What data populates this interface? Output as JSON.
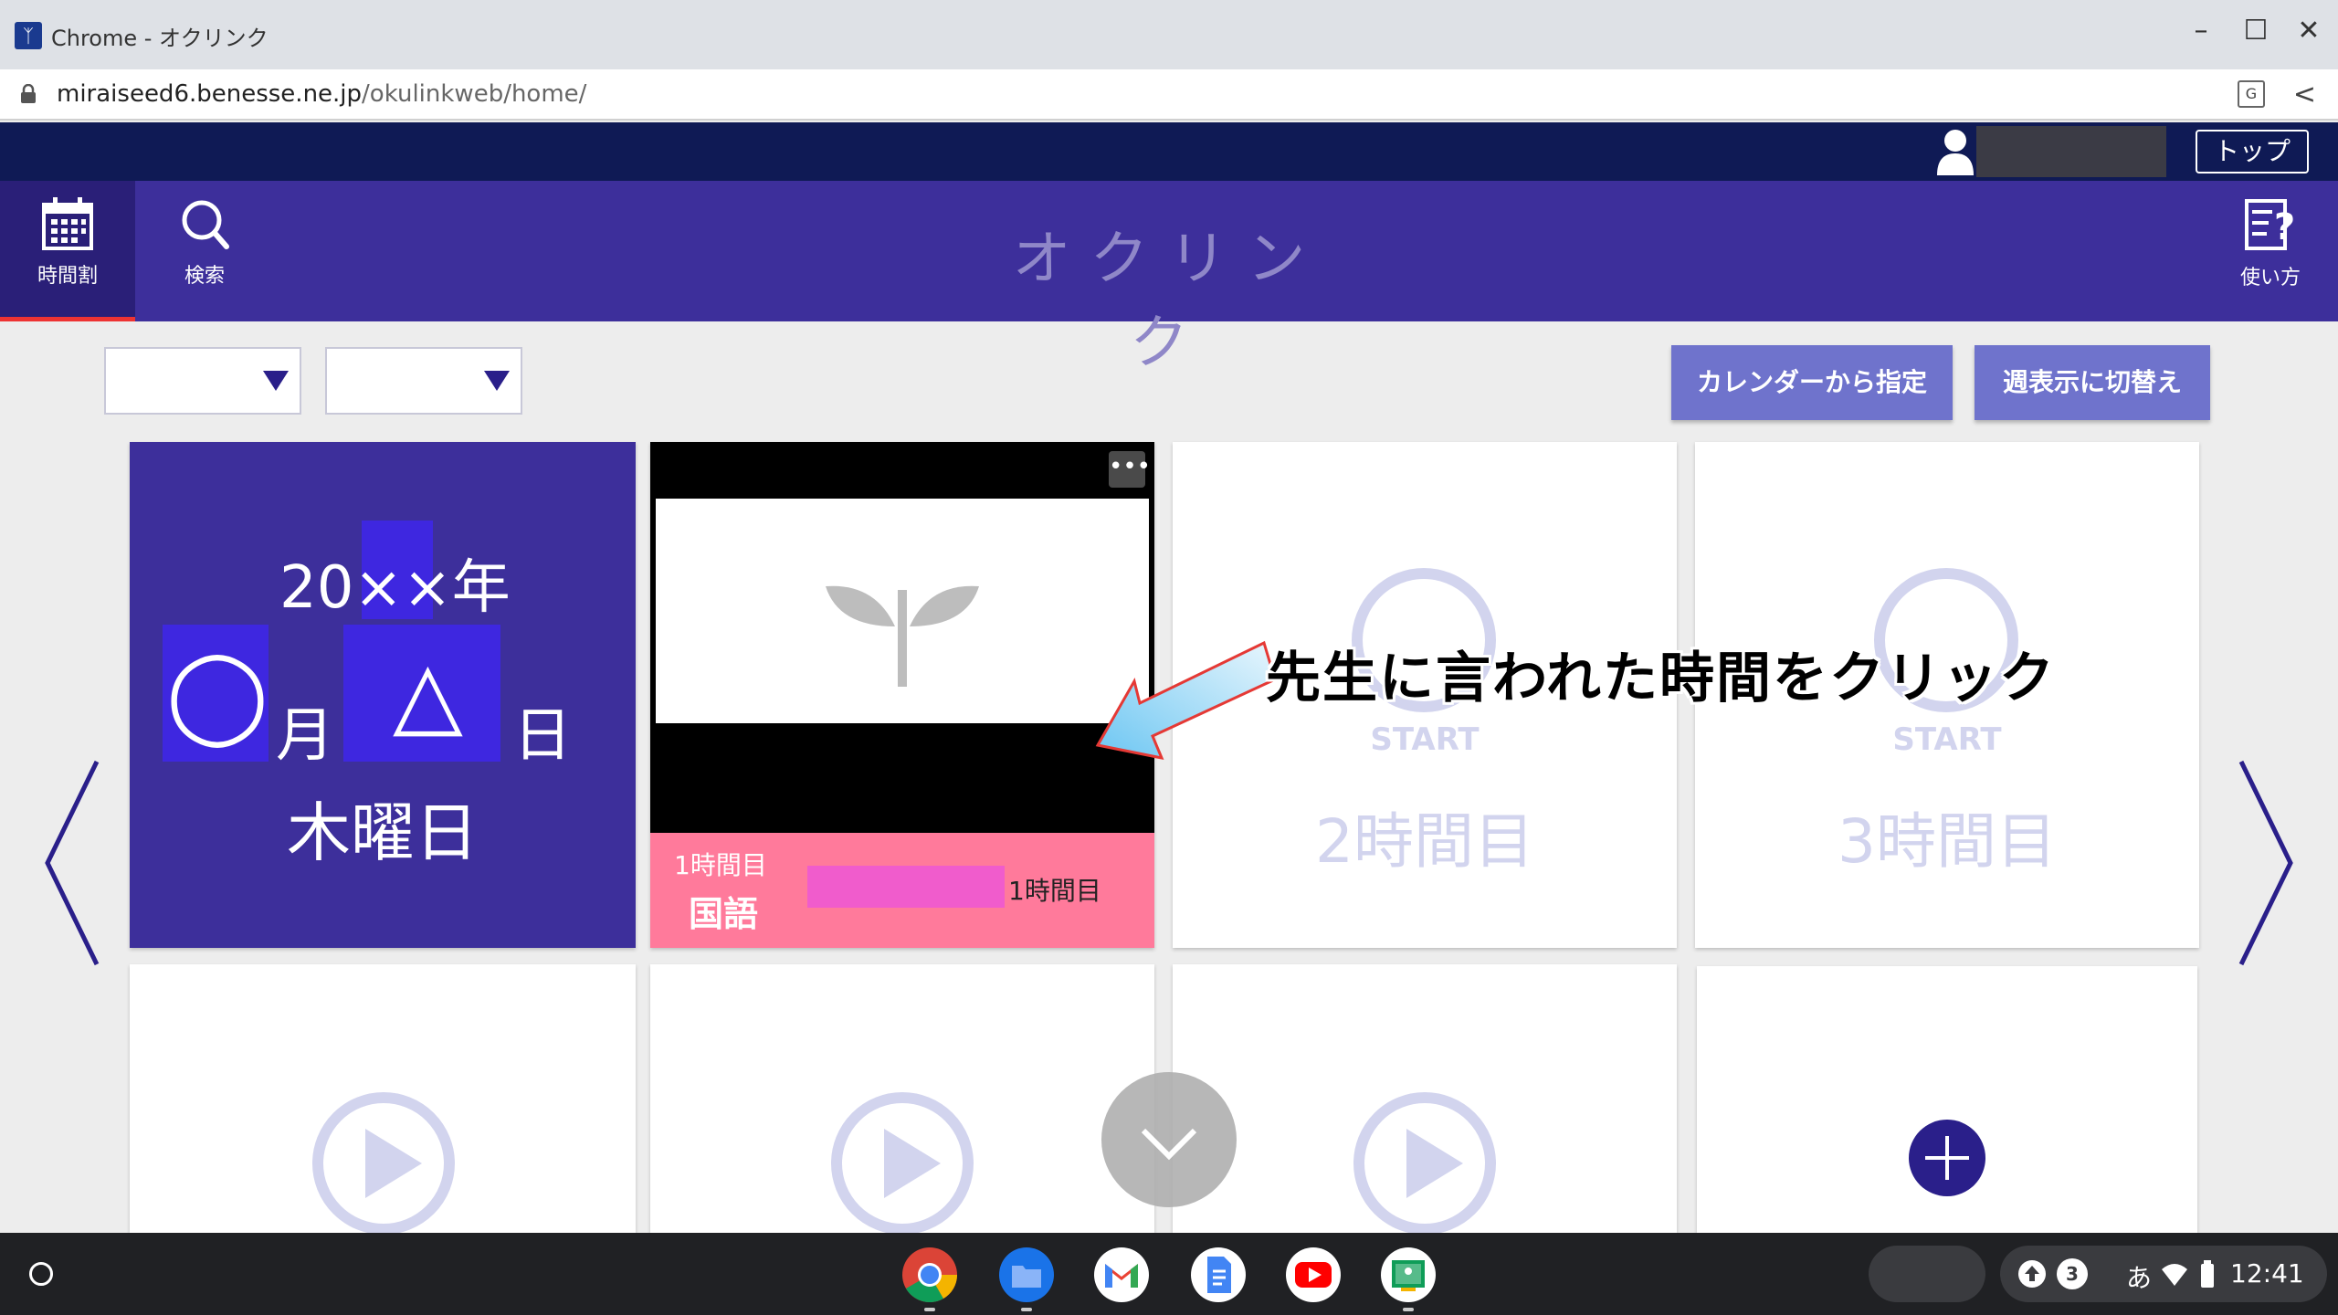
{
  "window": {
    "title": "Chrome - オクリンク"
  },
  "urlbar": {
    "domain": "miraiseed6.benesse.ne.jp",
    "path": "/okulinkweb/home/"
  },
  "header": {
    "top_button": "トップ"
  },
  "nav": {
    "timetable_label": "時間割",
    "search_label": "検索",
    "app_title": "オクリンク",
    "help_label": "使い方"
  },
  "controls": {
    "calendar_button": "カレンダーから指定",
    "week_button": "週表示に切替え"
  },
  "date_card": {
    "year": "20××年",
    "month_value": "◯",
    "month_unit": "月",
    "day_value": "△",
    "day_unit": "日",
    "weekday": "木曜日"
  },
  "lesson_card": {
    "menu_label": "•••",
    "period": "1時間目",
    "subject": "国語",
    "title_suffix": "1時間目"
  },
  "empty_cards": [
    {
      "start": "START",
      "period": "2時間目"
    },
    {
      "start": "START",
      "period": "3時間目"
    }
  ],
  "annotation": {
    "text": "先生に言われた時間をクリック"
  },
  "shelf": {
    "apps": [
      "chrome-icon",
      "files-icon",
      "gmail-icon",
      "docs-icon",
      "youtube-icon",
      "classroom-icon"
    ],
    "notification_count": "3",
    "ime": "あ",
    "time": "12:41"
  },
  "colors": {
    "nav_bg": "#3d2f9b",
    "header_bg": "#0f1a55",
    "button_bg": "#6f73cc",
    "lesson_footer": "#ff7a9b",
    "highlight": "#3e27e0"
  }
}
